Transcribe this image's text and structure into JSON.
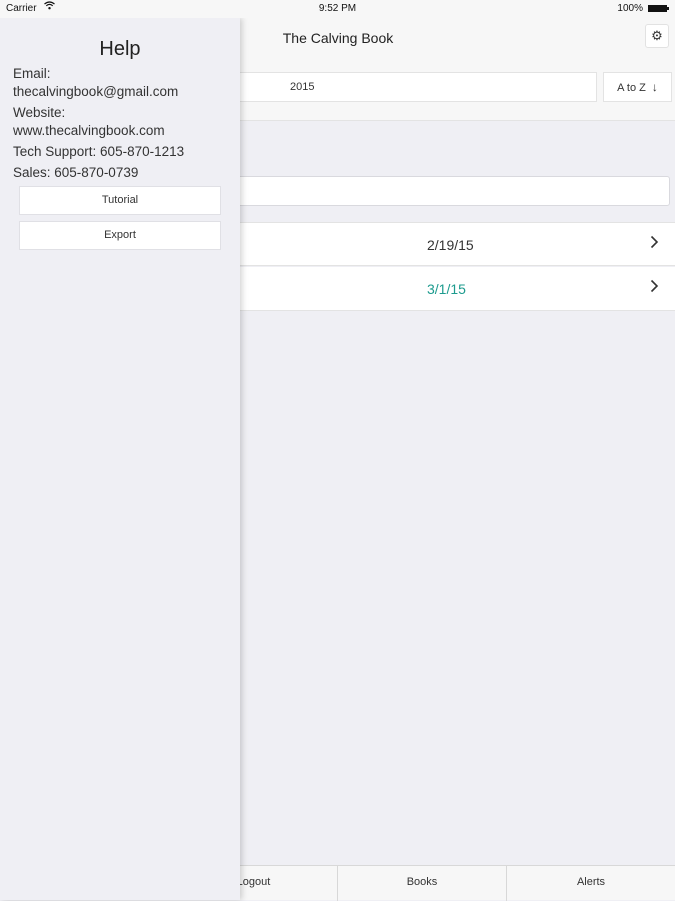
{
  "status_bar": {
    "carrier": "Carrier",
    "time": "9:52 PM",
    "battery": "100%",
    "wifi_icon": "wifi-icon",
    "battery_icon": "battery-icon"
  },
  "nav": {
    "title": "The Calving Book",
    "settings_icon": "gear-icon"
  },
  "controls": {
    "year": "2015",
    "sort_label": "A to Z",
    "sort_icon": "arrow-down-icon"
  },
  "list": {
    "rows": [
      {
        "date": "2/19/15"
      },
      {
        "date": "3/1/15"
      }
    ],
    "highlight_color": "#1d9b8e"
  },
  "tabs": {
    "logout": "Logout",
    "books": "Books",
    "alerts": "Alerts"
  },
  "help": {
    "title": "Help",
    "email_label": "Email:",
    "email": "thecalvingbook@gmail.com",
    "website_label": "Website:",
    "website": "www.thecalvingbook.com",
    "tech_support": "Tech Support: 605-870-1213",
    "sales": "Sales: 605-870-0739",
    "tutorial_button": "Tutorial",
    "export_button": "Export"
  }
}
